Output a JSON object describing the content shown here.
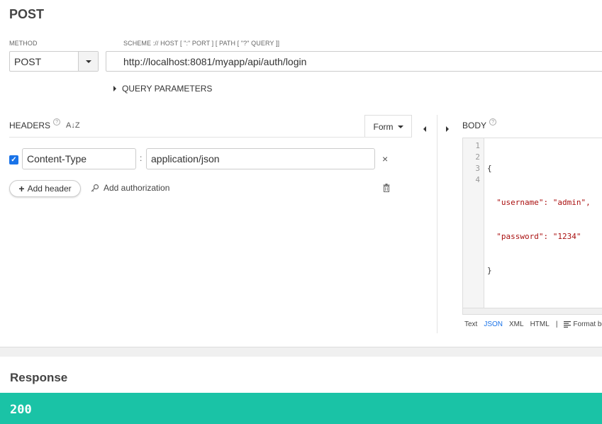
{
  "page": {
    "title": "POST"
  },
  "request": {
    "method_label": "METHOD",
    "method_value": "POST",
    "url_label": "SCHEME :// HOST [ \":\" PORT ] [ PATH [ \"?\" QUERY ]]",
    "url_value": "http://localhost:8081/myapp/api/auth/login",
    "query_params_label": "QUERY PARAMETERS"
  },
  "headers": {
    "title": "HEADERS",
    "help": "?",
    "sort_icon": "A↓Z",
    "form_label": "Form",
    "rows": [
      {
        "key": "Content-Type",
        "value": "application/json",
        "enabled": true
      }
    ],
    "add_header_label": "Add header",
    "add_auth_label": "Add authorization"
  },
  "body": {
    "title": "BODY",
    "help": "?",
    "line_numbers": [
      "1",
      "2",
      "3",
      "4"
    ],
    "lines": [
      "{",
      "  \"username\": \"admin\",",
      "  \"password\": \"1234\"",
      "}"
    ],
    "formats": [
      "Text",
      "JSON",
      "XML",
      "HTML"
    ],
    "active_format": "JSON",
    "separator": "|",
    "format_body_label": "Format body"
  },
  "response": {
    "title": "Response",
    "status_code": "200",
    "status_color": "#1ac3a6"
  },
  "colors": {
    "accent": "#1a73e8",
    "success": "#1ac3a6"
  }
}
